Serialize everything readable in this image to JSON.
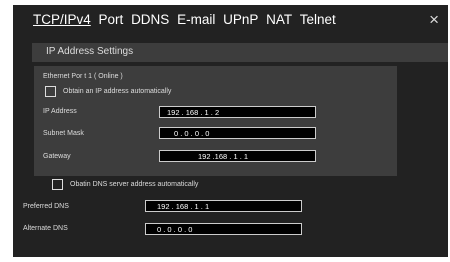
{
  "tabs": [
    {
      "label": "TCP/IPv4",
      "active": true
    },
    {
      "label": "Port",
      "active": false
    },
    {
      "label": "DDNS",
      "active": false
    },
    {
      "label": "E-mail",
      "active": false
    },
    {
      "label": "UPnP",
      "active": false
    },
    {
      "label": "NAT",
      "active": false
    },
    {
      "label": "Telnet",
      "active": false
    }
  ],
  "close_label": "×",
  "section_title": "IP Address Settings",
  "ethernet": {
    "title": "Ethernet Por t 1 ( Online )",
    "obtain_ip_label": "Obtain an IP address automatically",
    "ip_label": "IP Address",
    "ip_value": "192 . 168 . 1 . 2",
    "mask_label": "Subnet Mask",
    "mask_value": "0 . 0 . 0 . 0",
    "gateway_label": "Gateway",
    "gateway_value": "192  .168 . 1 . 1"
  },
  "dns": {
    "obtain_dns_label": "Obatin DNS server address automatically",
    "preferred_label": "Preferred DNS",
    "preferred_value": "192 . 168 . 1 . 1",
    "alternate_label": "Alternate DNS",
    "alternate_value": "0 . 0 . 0 . 0"
  },
  "colors": {
    "dialog_bg": "#222222",
    "panel_bg": "#3d3d3d",
    "field_bg": "#000000",
    "text": "#dddddd"
  }
}
